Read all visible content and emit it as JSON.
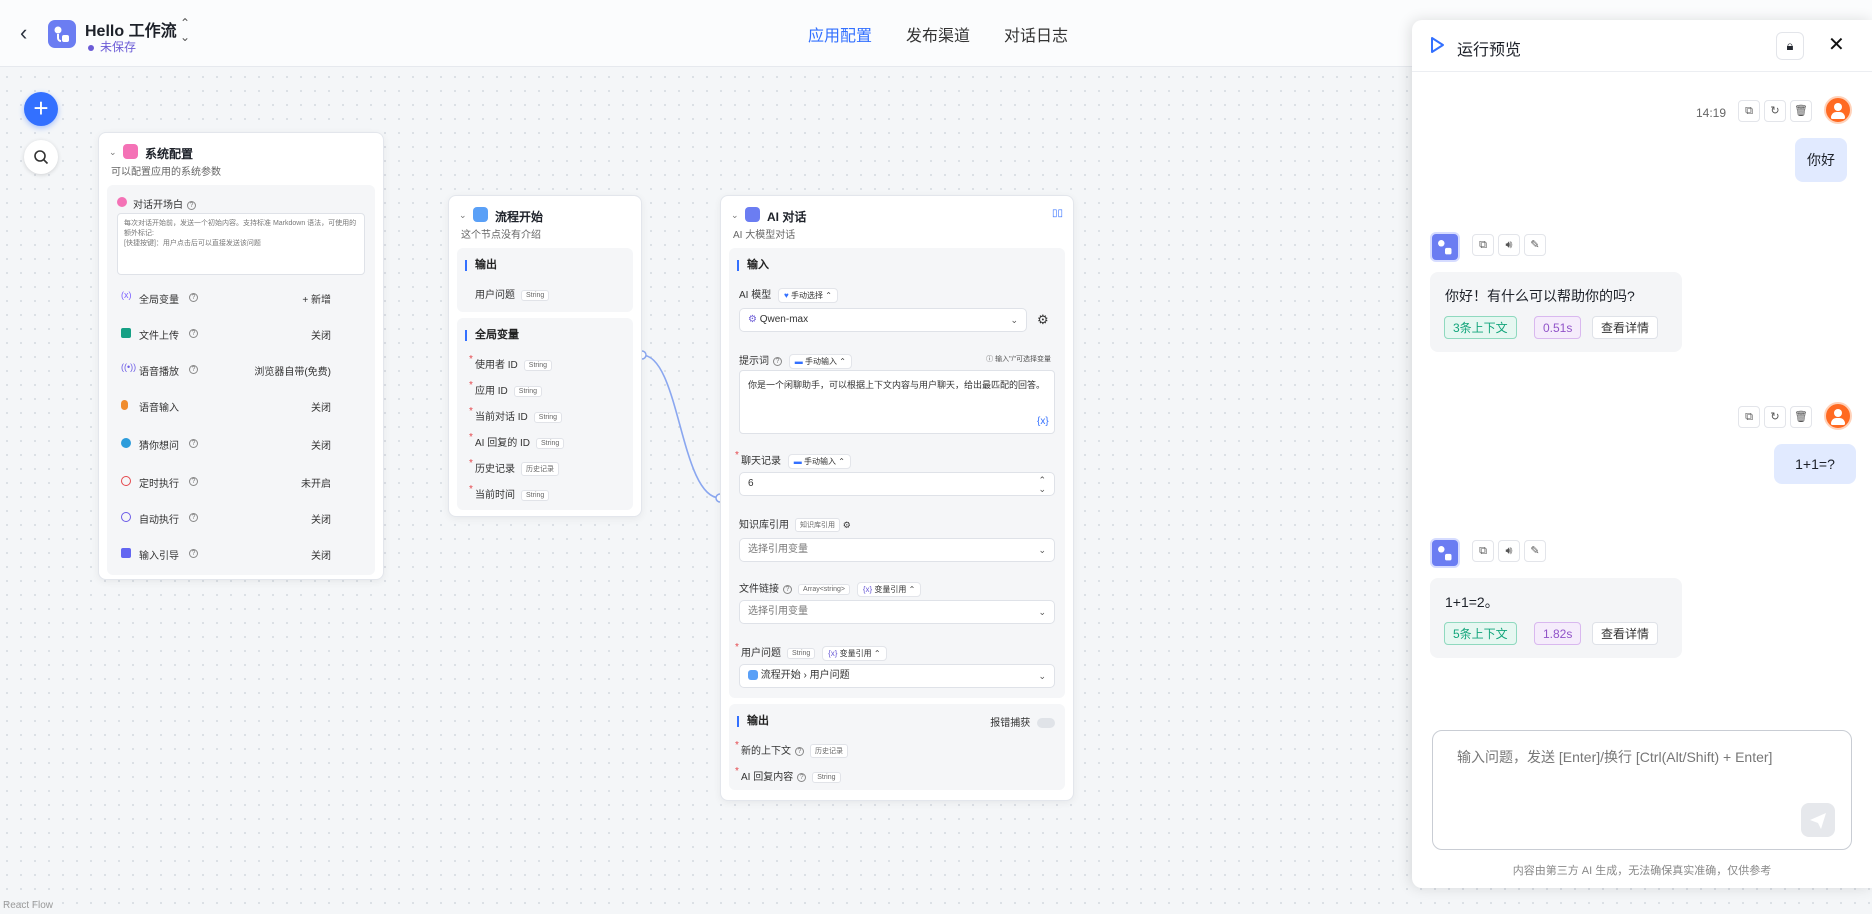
{
  "header": {
    "app_title": "Hello 工作流",
    "status": "未保存",
    "nav": [
      "应用配置",
      "发布渠道",
      "对话日志"
    ],
    "active_nav": 0
  },
  "canvas": {
    "footer": "React Flow"
  },
  "system_node": {
    "title": "系统配置",
    "desc": "可以配置应用的系统参数",
    "welcome_label": "对话开场白",
    "welcome_text": "每次对话开始前，发送一个初始内容。支持标准 Markdown 语法，可使用的额外标记:\n[快捷按键]：用户点击后可以直接发送该问题",
    "rows": [
      {
        "label": "全局变量",
        "value": "+ 新增",
        "color": "#7b61ff"
      },
      {
        "label": "文件上传",
        "value": "关闭",
        "color": "#16a085"
      },
      {
        "label": "语音播放",
        "value": "浏览器自带(免费)",
        "color": "#6c5ce7"
      },
      {
        "label": "语音输入",
        "value": "关闭",
        "color": "#f08c2e"
      },
      {
        "label": "猜你想问",
        "value": "关闭",
        "color": "#2d9cdb"
      },
      {
        "label": "定时执行",
        "value": "未开启",
        "color": "#e5484d"
      },
      {
        "label": "自动执行",
        "value": "关闭",
        "color": "#6c5ce7"
      },
      {
        "label": "输入引导",
        "value": "关闭",
        "color": "#6366f1"
      }
    ]
  },
  "start_node": {
    "title": "流程开始",
    "desc": "这个节点没有介绍",
    "output_title": "输出",
    "output_items": [
      {
        "label": "用户问题",
        "type": "String"
      }
    ],
    "global_title": "全局变量",
    "global_items": [
      {
        "label": "使用者 ID",
        "type": "String"
      },
      {
        "label": "应用 ID",
        "type": "String"
      },
      {
        "label": "当前对话 ID",
        "type": "String"
      },
      {
        "label": "AI 回复的 ID",
        "type": "String"
      },
      {
        "label": "历史记录",
        "type": "历史记录"
      },
      {
        "label": "当前时间",
        "type": "String"
      }
    ]
  },
  "ai_node": {
    "title": "AI 对话",
    "desc": "AI 大模型对话",
    "input_title": "输入",
    "model_label": "AI 模型",
    "model_mode": "手动选择",
    "model_value": "Qwen-max",
    "prompt_label": "提示词",
    "prompt_mode": "手动输入",
    "prompt_hint": "输入\"/\"可选择变量",
    "prompt_text": "你是一个闲聊助手，可以根据上下文内容与用户聊天，给出最匹配的回答。",
    "history_label": "聊天记录",
    "history_mode": "手动输入",
    "history_value": "6",
    "kb_label": "知识库引用",
    "kb_tag": "知识库引用",
    "kb_placeholder": "选择引用变量",
    "file_label": "文件链接",
    "file_tag": "Array<string>",
    "file_mode": "变量引用",
    "file_placeholder": "选择引用变量",
    "question_label": "用户问题",
    "question_tag": "String",
    "question_mode": "变量引用",
    "question_value": "流程开始 › 用户问题",
    "output_title": "输出",
    "catch_label": "报错捕获",
    "outputs": [
      {
        "label": "新的上下文",
        "type": "历史记录"
      },
      {
        "label": "AI 回复内容",
        "type": "String"
      }
    ]
  },
  "panel": {
    "title": "运行预览",
    "messages": [
      {
        "role": "user",
        "time": "14:19",
        "text": "你好"
      },
      {
        "role": "bot",
        "text": "你好！有什么可以帮助你的吗?",
        "ctx": "3条上下文",
        "dur": "0.51s",
        "detail": "查看详情"
      },
      {
        "role": "user",
        "time": "",
        "text": "1+1=?"
      },
      {
        "role": "bot",
        "text": "1+1=2。",
        "ctx": "5条上下文",
        "dur": "1.82s",
        "detail": "查看详情"
      }
    ],
    "input_placeholder": "输入问题，发送 [Enter]/换行 [Ctrl(Alt/Shift) + Enter]",
    "disclaimer": "内容由第三方 AI 生成，无法确保真实准确，仅供参考"
  }
}
